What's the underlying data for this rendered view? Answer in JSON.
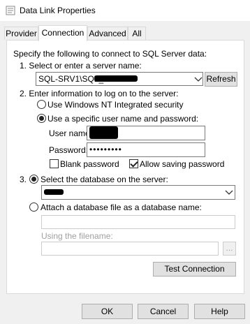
{
  "window": {
    "title": "Data Link Properties"
  },
  "tabs": [
    {
      "label": "Provider"
    },
    {
      "label": "Connection"
    },
    {
      "label": "Advanced"
    },
    {
      "label": "All"
    }
  ],
  "connection": {
    "intro": "Specify the following to connect to SQL Server data:",
    "step1_label": "1. Select or enter a server name:",
    "server_value": "SQL-SRV1\\SQL_",
    "refresh_label": "Refresh",
    "step2_label": "2. Enter information to log on to the server:",
    "windows_auth_label": "Use Windows NT Integrated security",
    "specific_auth_label": "Use a specific user name and password:",
    "username_label": "User name:",
    "password_label": "Password:",
    "password_value": "•••••••••",
    "blank_password_label": "Blank password",
    "allow_saving_label": "Allow saving password",
    "step3_prefix": "3.",
    "select_db_label": "Select the database on the server:",
    "attach_db_label": "Attach a database file as a database name:",
    "using_filename_label": "Using the filename:",
    "browse_label": "...",
    "test_connection_label": "Test Connection"
  },
  "footer": {
    "ok_label": "OK",
    "cancel_label": "Cancel",
    "help_label": "Help"
  },
  "state": {
    "windows_auth_selected": false,
    "specific_auth_selected": true,
    "blank_password_checked": false,
    "allow_saving_checked": true,
    "select_db_selected": true,
    "attach_db_selected": false
  }
}
